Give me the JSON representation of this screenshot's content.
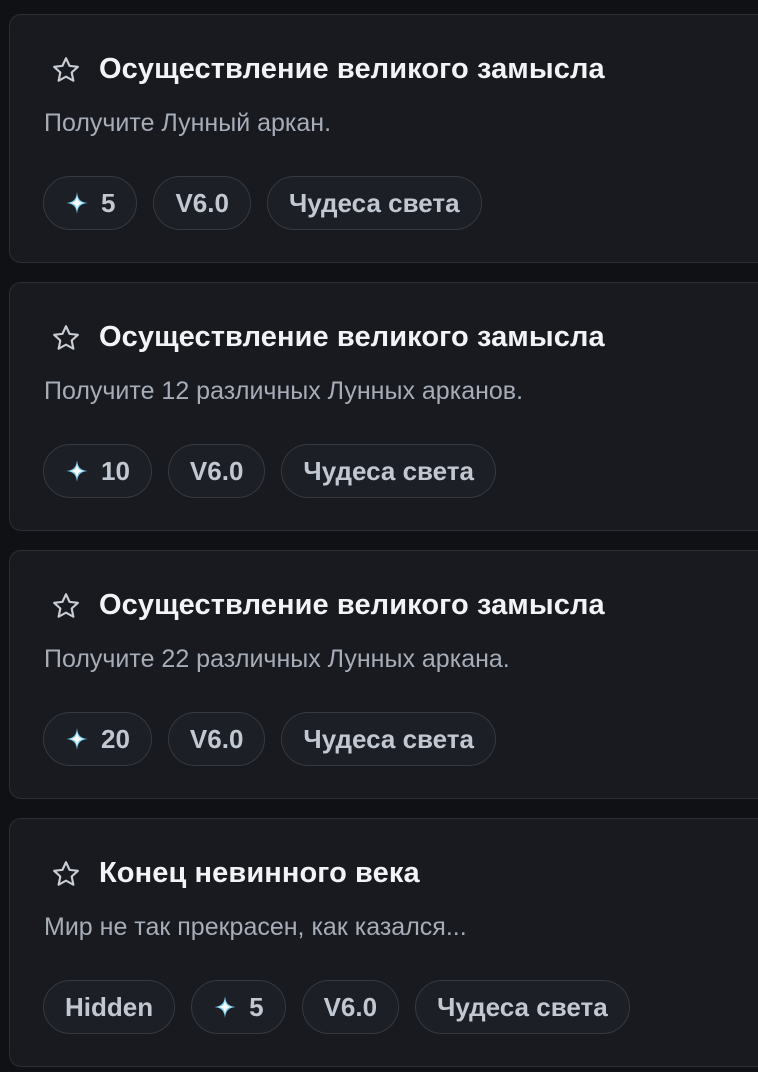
{
  "achievements": [
    {
      "title": "Осуществление великого замысла",
      "description": "Получите Лунный аркан.",
      "hidden_label": null,
      "reward": "5",
      "version": "V6.0",
      "category": "Чудеса света"
    },
    {
      "title": "Осуществление великого замысла",
      "description": "Получите 12 различных Лунных арканов.",
      "hidden_label": null,
      "reward": "10",
      "version": "V6.0",
      "category": "Чудеса света"
    },
    {
      "title": "Осуществление великого замысла",
      "description": "Получите 22 различных Лунных аркана.",
      "hidden_label": null,
      "reward": "20",
      "version": "V6.0",
      "category": "Чудеса света"
    },
    {
      "title": "Конец невинного века",
      "description": "Мир не так прекрасен, как казался...",
      "hidden_label": "Hidden",
      "reward": "5",
      "version": "V6.0",
      "category": "Чудеса света"
    }
  ],
  "icons": {
    "favorite": "star-outline-icon",
    "reward": "primogem-icon"
  },
  "colors": {
    "background": "#0f1114",
    "card": "#181a1f",
    "card_border": "#2b2f36",
    "title": "#f1f3f5",
    "description": "#a6adb8",
    "tag_text": "#c2c8d2",
    "gem_light": "#ffffff",
    "gem_blue": "#7fd3f2"
  }
}
